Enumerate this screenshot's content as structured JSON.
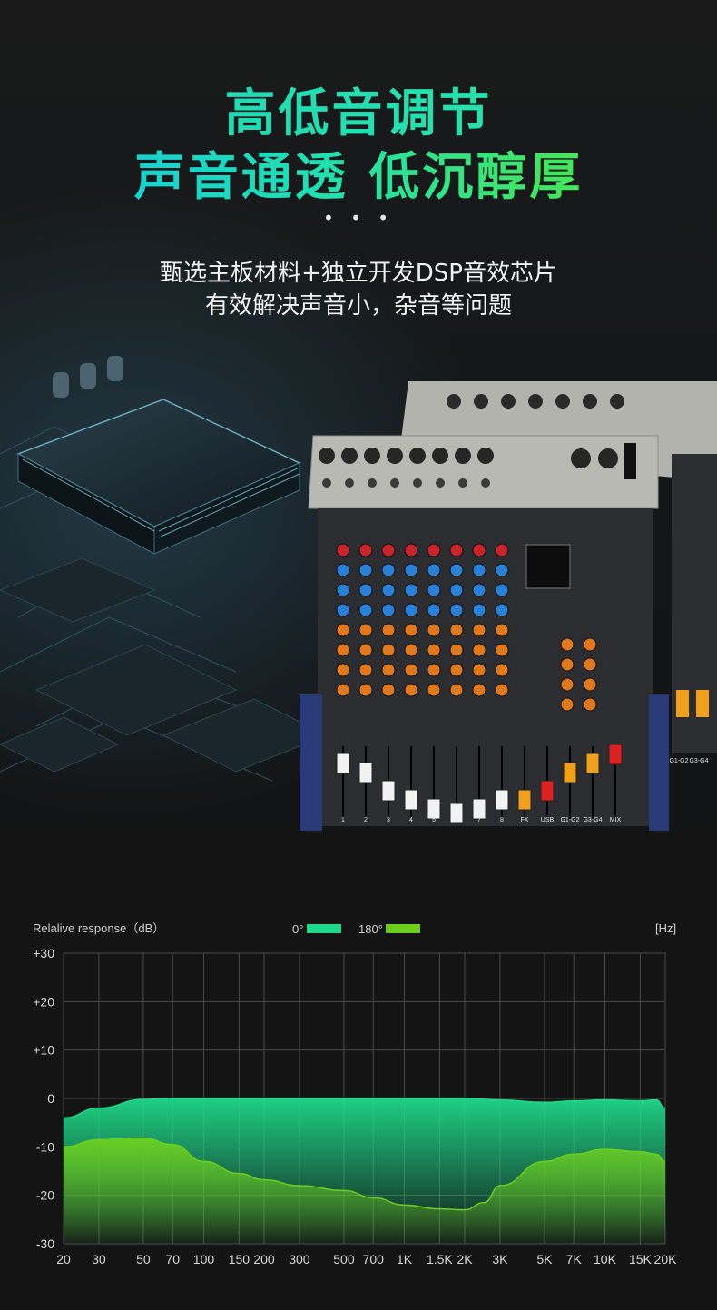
{
  "hero": {
    "title_line1": "高低音调节",
    "title_line2": "声音通透 低沉醇厚",
    "dots": "• • •",
    "subtitle_line1": "甄选主板材料+独立开发DSP音效芯片",
    "subtitle_line2": "有效解决声音小，杂音等问题"
  },
  "mixer": {
    "channel_labels": [
      "1",
      "2",
      "3",
      "4",
      "5",
      "6",
      "7",
      "8",
      "FX",
      "USB",
      "G1-G2",
      "G3-G4",
      "MIX"
    ],
    "side_labels": [
      "G1-G2",
      "G3-G4"
    ],
    "colors": {
      "body": "#2b2d31",
      "panel": "#b9b9b4",
      "knob_red": "#c8242b",
      "knob_blue": "#2a7fd6",
      "knob_orange": "#e0781e",
      "fader_white": "#f2f2f2",
      "fader_orange": "#f0a01a",
      "fader_red": "#e02020",
      "base_blue": "#2a3a78"
    }
  },
  "chart_data": {
    "type": "area",
    "ylabel": "Relalive response（dB）",
    "xunit": "[Hz]",
    "legend_position": "top",
    "grid": true,
    "ylim": [
      -30,
      30
    ],
    "y_ticks": [
      "+30",
      "+20",
      "+10",
      "0",
      "-10",
      "-20",
      "-30"
    ],
    "x_tick_labels": [
      "20",
      "30",
      "50",
      "70",
      "100",
      "150",
      "200",
      "300",
      "500",
      "700",
      "1K",
      "1.5K",
      "2K",
      "3K",
      "5K",
      "7K",
      "10K",
      "15K",
      "20K"
    ],
    "x_log_scale": true,
    "series": [
      {
        "name": "0°",
        "color": "#1fd98a",
        "x": [
          20,
          30,
          50,
          70,
          100,
          150,
          200,
          300,
          500,
          700,
          1000,
          1500,
          2000,
          3000,
          5000,
          7000,
          10000,
          15000,
          18000,
          20000
        ],
        "y": [
          -4,
          -2,
          -0.2,
          0,
          0,
          0,
          0,
          0,
          0,
          0,
          0,
          0,
          0,
          -0.3,
          -0.8,
          -0.5,
          -0.3,
          -0.5,
          -0.3,
          -2
        ]
      },
      {
        "name": "180°",
        "color": "#6ccf1e",
        "x": [
          20,
          30,
          50,
          70,
          100,
          150,
          200,
          300,
          500,
          700,
          1000,
          1500,
          2000,
          2500,
          3000,
          5000,
          7000,
          10000,
          15000,
          18000,
          20000
        ],
        "y": [
          -10,
          -8.5,
          -8.2,
          -9.5,
          -13,
          -15.5,
          -16.8,
          -18,
          -19,
          -20.5,
          -22,
          -22.8,
          -23,
          -21.5,
          -18,
          -13,
          -11.5,
          -10.5,
          -11,
          -11.5,
          -13
        ]
      }
    ]
  }
}
